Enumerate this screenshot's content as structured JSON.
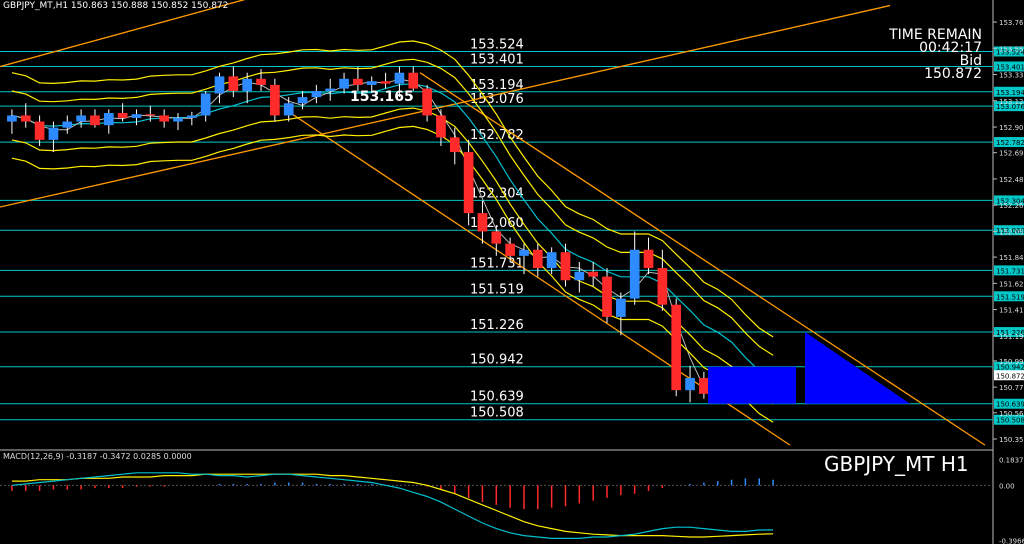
{
  "header": {
    "text": "GBPJPY_MT,H1  150.863 150.888 150.852 150.872"
  },
  "symbol_label": "GBPJPY_MT H1",
  "info": {
    "time_remain_label": "TIME REMAIN",
    "time_remain": "00:42:17",
    "bid_label": "Bid",
    "bid": "150.872"
  },
  "colors": {
    "bg": "#000000",
    "level": "#00c8c8",
    "bull": "#2e8bff",
    "bear": "#ff2a2a",
    "band": "#ffee00",
    "trend": "#ff9900",
    "ma": "#00c0d0"
  },
  "chart_data": [
    {
      "type": "candlestick",
      "title": "GBPJPY_MT,H1",
      "ylim": [
        150.26,
        153.88
      ],
      "y_ticks": [
        "153.765",
        "153.550",
        "153.335",
        "153.120",
        "152.905",
        "152.695",
        "152.480",
        "152.265",
        "152.050",
        "151.840",
        "151.625",
        "151.410",
        "151.195",
        "150.990",
        "150.775",
        "150.565",
        "150.350"
      ],
      "y_tick_values": [
        153.765,
        153.55,
        153.335,
        153.12,
        152.905,
        152.695,
        152.48,
        152.265,
        152.05,
        151.84,
        151.625,
        151.41,
        151.195,
        150.99,
        150.775,
        150.565,
        150.35
      ],
      "levels": [
        153.524,
        153.401,
        153.194,
        153.076,
        152.782,
        152.304,
        152.06,
        151.731,
        151.519,
        151.226,
        150.942,
        150.639,
        150.508
      ],
      "level_labels": [
        "153.524",
        "153.401",
        "153.194",
        "153.076",
        "152.782",
        "152.304",
        "152.060",
        "151.731",
        "151.519",
        "151.226",
        "150.942",
        "150.639",
        "150.508"
      ],
      "current_price_label": "153.165",
      "current_price_tag": "150.872",
      "candles": [
        [
          152.95,
          153.05,
          152.85,
          153.0
        ],
        [
          153.0,
          153.1,
          152.9,
          152.95
        ],
        [
          152.95,
          153.0,
          152.75,
          152.8
        ],
        [
          152.8,
          152.95,
          152.7,
          152.9
        ],
        [
          152.9,
          153.0,
          152.85,
          152.95
        ],
        [
          152.95,
          153.05,
          152.9,
          153.0
        ],
        [
          153.0,
          153.05,
          152.9,
          152.92
        ],
        [
          152.92,
          153.05,
          152.85,
          153.02
        ],
        [
          153.02,
          153.1,
          152.95,
          152.98
        ],
        [
          152.98,
          153.05,
          152.92,
          153.01
        ],
        [
          153.01,
          153.08,
          152.95,
          153.0
        ],
        [
          153.0,
          153.05,
          152.9,
          152.95
        ],
        [
          152.95,
          153.02,
          152.88,
          152.98
        ],
        [
          152.98,
          153.03,
          152.92,
          153.0
        ],
        [
          153.0,
          153.2,
          152.95,
          153.18
        ],
        [
          153.18,
          153.35,
          153.1,
          153.32
        ],
        [
          153.32,
          153.4,
          153.15,
          153.2
        ],
        [
          153.2,
          153.35,
          153.1,
          153.3
        ],
        [
          153.3,
          153.38,
          153.2,
          153.25
        ],
        [
          153.25,
          153.3,
          152.95,
          153.0
        ],
        [
          153.0,
          153.15,
          152.95,
          153.1
        ],
        [
          153.1,
          153.2,
          153.05,
          153.15
        ],
        [
          153.15,
          153.25,
          153.1,
          153.2
        ],
        [
          153.2,
          153.3,
          153.12,
          153.22
        ],
        [
          153.22,
          153.35,
          153.18,
          153.3
        ],
        [
          153.3,
          153.4,
          153.2,
          153.25
        ],
        [
          153.25,
          153.32,
          153.2,
          153.28
        ],
        [
          153.28,
          153.35,
          153.22,
          153.26
        ],
        [
          153.26,
          153.4,
          153.15,
          153.35
        ],
        [
          153.35,
          153.4,
          153.2,
          153.22
        ],
        [
          153.22,
          153.25,
          152.95,
          153.0
        ],
        [
          153.0,
          153.05,
          152.75,
          152.82
        ],
        [
          152.82,
          152.9,
          152.6,
          152.7
        ],
        [
          152.7,
          152.8,
          152.1,
          152.2
        ],
        [
          152.2,
          152.3,
          151.95,
          152.05
        ],
        [
          152.05,
          152.1,
          151.85,
          151.95
        ],
        [
          151.95,
          152.0,
          151.8,
          151.85
        ],
        [
          151.85,
          151.95,
          151.7,
          151.9
        ],
        [
          151.9,
          151.95,
          151.68,
          151.75
        ],
        [
          151.75,
          151.92,
          151.7,
          151.88
        ],
        [
          151.88,
          151.95,
          151.6,
          151.65
        ],
        [
          151.65,
          151.8,
          151.55,
          151.72
        ],
        [
          151.72,
          151.8,
          151.6,
          151.68
        ],
        [
          151.68,
          151.75,
          151.3,
          151.35
        ],
        [
          151.35,
          151.55,
          151.2,
          151.5
        ],
        [
          151.5,
          152.05,
          151.45,
          151.9
        ],
        [
          151.9,
          152.0,
          151.7,
          151.75
        ],
        [
          151.75,
          151.9,
          151.4,
          151.45
        ],
        [
          151.45,
          151.5,
          150.7,
          150.75
        ],
        [
          150.75,
          150.95,
          150.65,
          150.85
        ],
        [
          150.85,
          150.9,
          150.68,
          150.72
        ],
        [
          150.72,
          150.9,
          150.7,
          150.88
        ],
        [
          150.88,
          150.95,
          150.8,
          150.85
        ],
        [
          150.85,
          150.92,
          150.8,
          150.9
        ],
        [
          150.9,
          150.93,
          150.85,
          150.87
        ],
        [
          150.863,
          150.888,
          150.852,
          150.872
        ]
      ]
    },
    {
      "type": "bar",
      "title": "MACD(12,26,9)",
      "header": "MACD(12,26,9) -0.3187 -0.3472 0.0285 0.0000",
      "ylim": [
        -0.42,
        0.21
      ],
      "y_ticks": [
        "0.1837",
        "0.00",
        "-0.3966"
      ],
      "y_tick_values": [
        0.1837,
        0.0,
        -0.3966
      ],
      "histogram": [
        -0.04,
        -0.04,
        -0.04,
        -0.03,
        -0.03,
        -0.03,
        -0.02,
        -0.02,
        -0.02,
        -0.01,
        -0.01,
        -0.01,
        0.0,
        0.0,
        0.0,
        0.01,
        0.01,
        0.01,
        0.01,
        0.02,
        0.02,
        0.02,
        0.01,
        0.01,
        0.01,
        0.01,
        0.01,
        0.0,
        0.0,
        0.0,
        -0.01,
        -0.03,
        -0.06,
        -0.09,
        -0.12,
        -0.14,
        -0.16,
        -0.17,
        -0.17,
        -0.16,
        -0.15,
        -0.13,
        -0.11,
        -0.09,
        -0.07,
        -0.06,
        -0.04,
        -0.02,
        0.0,
        0.01,
        0.02,
        0.03,
        0.04,
        0.05,
        0.05,
        0.04
      ],
      "signal": [
        0.03,
        0.03,
        0.04,
        0.04,
        0.04,
        0.05,
        0.05,
        0.05,
        0.06,
        0.06,
        0.06,
        0.07,
        0.07,
        0.07,
        0.08,
        0.08,
        0.08,
        0.08,
        0.08,
        0.08,
        0.08,
        0.08,
        0.08,
        0.07,
        0.07,
        0.06,
        0.05,
        0.04,
        0.03,
        0.02,
        0.0,
        -0.03,
        -0.06,
        -0.1,
        -0.14,
        -0.18,
        -0.22,
        -0.26,
        -0.29,
        -0.31,
        -0.33,
        -0.34,
        -0.35,
        -0.355,
        -0.36,
        -0.36,
        -0.36,
        -0.36,
        -0.365,
        -0.37,
        -0.37,
        -0.365,
        -0.36,
        -0.355,
        -0.35,
        -0.3472
      ],
      "macd": [
        0.0,
        0.01,
        0.02,
        0.03,
        0.04,
        0.05,
        0.06,
        0.07,
        0.08,
        0.09,
        0.09,
        0.09,
        0.09,
        0.08,
        0.08,
        0.07,
        0.07,
        0.06,
        0.07,
        0.08,
        0.08,
        0.07,
        0.06,
        0.05,
        0.04,
        0.03,
        0.02,
        0.0,
        -0.02,
        -0.05,
        -0.08,
        -0.12,
        -0.17,
        -0.22,
        -0.27,
        -0.31,
        -0.34,
        -0.36,
        -0.37,
        -0.38,
        -0.38,
        -0.38,
        -0.37,
        -0.37,
        -0.36,
        -0.35,
        -0.33,
        -0.31,
        -0.3,
        -0.3,
        -0.31,
        -0.32,
        -0.33,
        -0.33,
        -0.32,
        -0.3187
      ]
    }
  ]
}
